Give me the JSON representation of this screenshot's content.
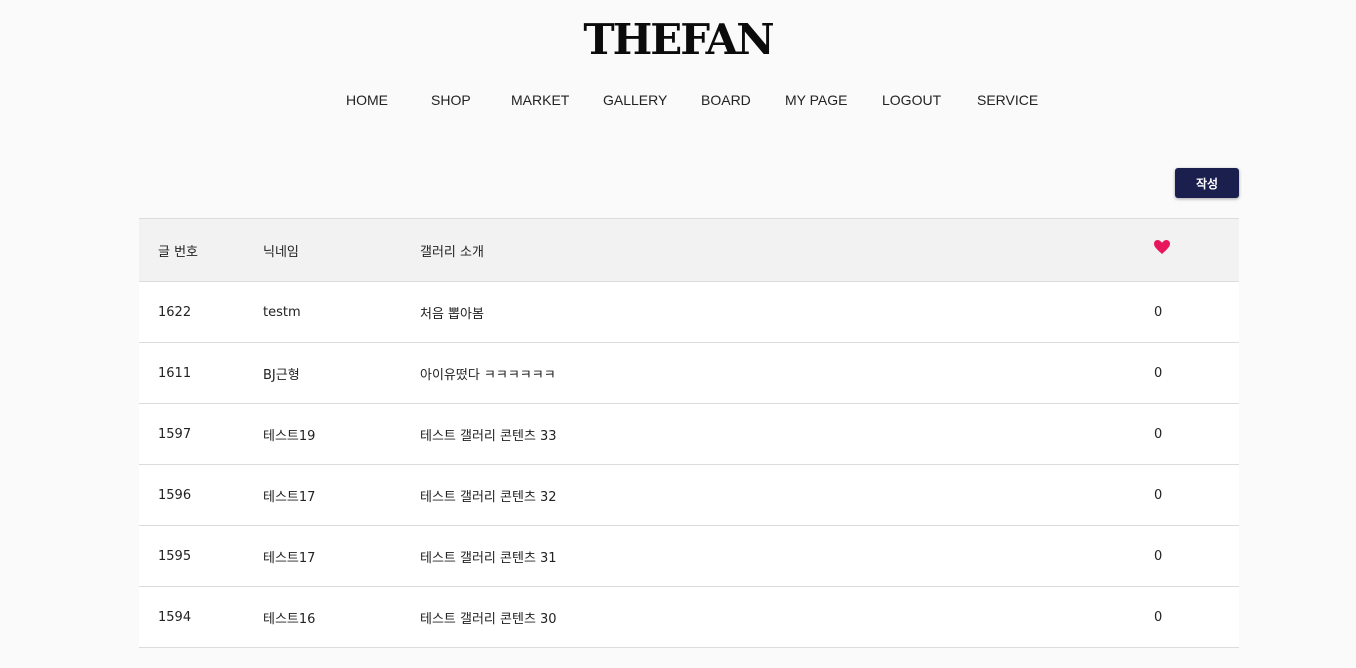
{
  "brand": {
    "logo_text": "THEFAN",
    "heart_color": "#e8175d",
    "button_color": "#1b1f4e"
  },
  "nav": {
    "items": [
      {
        "id": "home",
        "label": "HOME"
      },
      {
        "id": "shop",
        "label": "SHOP"
      },
      {
        "id": "market",
        "label": "MARKET"
      },
      {
        "id": "gallery",
        "label": "GALLERY"
      },
      {
        "id": "board",
        "label": "BOARD"
      },
      {
        "id": "mypage",
        "label": "MY PAGE"
      },
      {
        "id": "logout",
        "label": "LOGOUT"
      },
      {
        "id": "service",
        "label": "SERVICE"
      }
    ]
  },
  "toolbar": {
    "write_label": "작성"
  },
  "table": {
    "headers": {
      "no": "글 번호",
      "nickname": "닉네임",
      "intro": "갤러리 소개",
      "like_icon": "heart-icon"
    },
    "rows": [
      {
        "no": "1622",
        "nickname": "testm",
        "intro": "처음 뽑아봄",
        "likes": "0"
      },
      {
        "no": "1611",
        "nickname": "BJ근형",
        "intro": "아이유떴다 ㅋㅋㅋㅋㅋㅋ",
        "likes": "0"
      },
      {
        "no": "1597",
        "nickname": "테스트19",
        "intro": "테스트 갤러리 콘텐츠 33",
        "likes": "0"
      },
      {
        "no": "1596",
        "nickname": "테스트17",
        "intro": "테스트 갤러리 콘텐츠 32",
        "likes": "0"
      },
      {
        "no": "1595",
        "nickname": "테스트17",
        "intro": "테스트 갤러리 콘텐츠 31",
        "likes": "0"
      },
      {
        "no": "1594",
        "nickname": "테스트16",
        "intro": "테스트 갤러리 콘텐츠 30",
        "likes": "0"
      }
    ]
  }
}
